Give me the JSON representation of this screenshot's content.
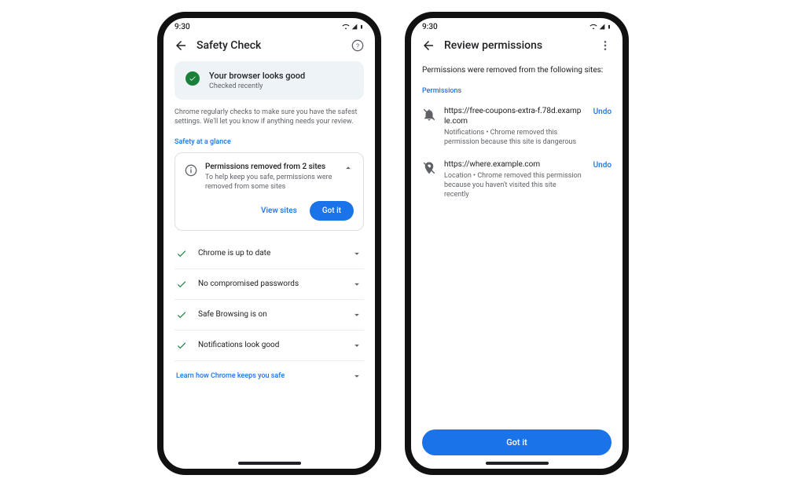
{
  "status_time": "9:30",
  "left": {
    "title": "Safety Check",
    "banner_title": "Your browser looks good",
    "banner_sub": "Checked recently",
    "description": "Chrome regularly checks to make sure you have the safest settings. We'll let you know if anything needs your review.",
    "glance_label": "Safety at a glance",
    "perm_card_title": "Permissions removed from 2 sites",
    "perm_card_sub": "To help keep you safe, permissions were removed from some sites",
    "view_sites": "View sites",
    "got_it": "Got it",
    "checks": [
      "Chrome is up to date",
      "No compromised passwords",
      "Safe Browsing is on",
      "Notifications look good"
    ],
    "learn": "Learn how Chrome keeps you safe"
  },
  "right": {
    "title": "Review permissions",
    "subhead": "Permissions were removed from the following sites:",
    "perm_label": "Permissions",
    "items": [
      {
        "url": "https://free-coupons-extra-f.78d.example.com",
        "desc": "Notifications • Chrome removed this permission because this site is dangerous",
        "undo": "Undo"
      },
      {
        "url": "https://where.example.com",
        "desc": "Location • Chrome removed this permission because you haven't visited this site recently",
        "undo": "Undo"
      }
    ],
    "got_it": "Got it"
  }
}
